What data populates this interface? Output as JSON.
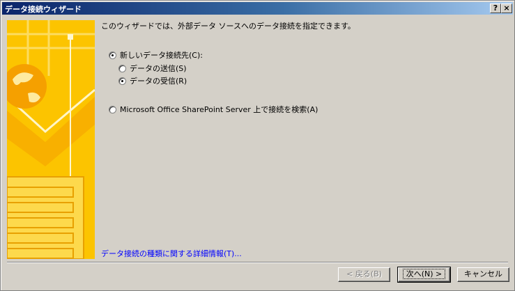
{
  "window": {
    "title": "データ接続ウィザード",
    "help_label": "?",
    "close_label": "×"
  },
  "intro_text": "このウィザードでは、外部データ ソースへのデータ接続を指定できます。",
  "options": {
    "new_connection": {
      "label": "新しいデータ接続先(C):",
      "checked": true
    },
    "send_data": {
      "label": "データの送信(S)",
      "checked": false
    },
    "receive_data": {
      "label": "データの受信(R)",
      "checked": true
    },
    "sharepoint": {
      "label": "Microsoft Office SharePoint Server 上で接続を検索(A)",
      "checked": false
    }
  },
  "help_link": "データ接続の種類に関する詳細情報(T)...",
  "buttons": {
    "back": "< 戻る(B)",
    "next": "次へ(N) >",
    "cancel": "キャンセル"
  },
  "colors": {
    "banner": "#fcc400",
    "titlebar_start": "#0a246a",
    "link": "#0000ff"
  }
}
